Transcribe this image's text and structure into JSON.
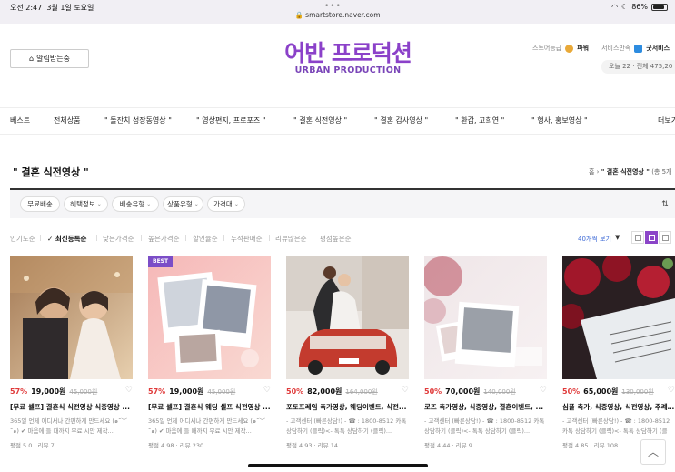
{
  "status_bar": {
    "time": "오전 2:47",
    "date": "3월 1일 토요일",
    "battery": "86%",
    "battery_level": 0.86
  },
  "browser": {
    "url": "smartstore.naver.com"
  },
  "header": {
    "alert_button": "알림받는중",
    "logo_ko": "어반 프로덕션",
    "logo_en": "URBAN PRODUCTION",
    "store_grade_label": "스토어등급",
    "store_grade_value": "파워",
    "service_label": "서비스만족",
    "service_value": "굿서비스",
    "visits": "오늘 22 · 전체 475,20"
  },
  "nav": [
    "베스트",
    "전체상품",
    "\" 돌잔치 성장동영상 \"",
    "\" 영상편지, 프로포즈 \"",
    "\" 결혼 식전영상 \"",
    "\" 결혼 감사영상 \"",
    "\" 환갑, 고희연 \"",
    "\" 행사, 홍보영상 \"",
    "더보기"
  ],
  "category": {
    "title": "\" 결혼 식전영상 \"",
    "breadcrumb_home": "홈",
    "breadcrumb_current": "\" 결혼 식전영상 \"",
    "breadcrumb_count": "(총 5개"
  },
  "filters": [
    "무료배송",
    "혜택정보",
    "배송유형",
    "상품유형",
    "가격대"
  ],
  "sort": {
    "options": [
      "인기도순",
      "최신등록순",
      "낮은가격순",
      "높은가격순",
      "할인율순",
      "누적판매순",
      "리뷰많은순",
      "평점높은순"
    ],
    "active_index": 1,
    "view_count": "40개씩 보기"
  },
  "products": [
    {
      "badge": "",
      "discount": "57%",
      "price": "19,000원",
      "original": "45,000원",
      "name": "[무료 셀프] 결혼식 식전영상 식중영상 ...",
      "desc": "365일 언제 어디서나 간편하게 만드세요 (๑˘︶˘๑) ✔ 마음에 들 때까지 무료 시안 제작...",
      "meta": "평점 5.0 · 리뷰 7"
    },
    {
      "badge": "BEST",
      "discount": "57%",
      "price": "19,000원",
      "original": "45,000원",
      "name": "[무료 셀프] 결혼식 웨딩 셀프 식전영상 ...",
      "desc": "365일 언제 어디서나 간편하게 만드세요 (๑˘︶˘๑) ✔ 마음에 들 때까지 무료 시안 제작...",
      "meta": "평점 4.98 · 리뷰 230"
    },
    {
      "badge": "",
      "discount": "50%",
      "price": "82,000원",
      "original": "164,000원",
      "name": "포토프레임 축가영상, 웨딩이벤트, 식전...",
      "desc": "- 고객센터 (빠른상담!) - ☎ : 1800-8512 카톡 상담하기 (클릭)<- 톡톡 상담하기 (클릭)...",
      "meta": "평점 4.93 · 리뷰 14"
    },
    {
      "badge": "",
      "discount": "50%",
      "price": "70,000원",
      "original": "140,000원",
      "name": "로즈 축가영상, 식중영상, 결혼이벤트, ...",
      "desc": "- 고객센터 (빠른상담!) - ☎ : 1800-8512 카톡 상담하기 (클릭)<- 톡톡 상담하기 (클릭)...",
      "meta": "평점 4.44 · 리뷰 9"
    },
    {
      "badge": "",
      "discount": "50%",
      "price": "65,000원",
      "original": "130,000원",
      "name": "심플 축가, 식중영상, 식전영상, 주례없...",
      "desc": "- 고객센터 (빠른상담!) - ☎ : 1800-8512 카톡 상담하기 (클릭)<- 톡톡 상담하기 (클릭)...",
      "meta": "평점 4.85 · 리뷰 108"
    }
  ],
  "colors": {
    "brand": "#8b41c9",
    "discount": "#e03b3b",
    "link": "#3c69d6"
  }
}
